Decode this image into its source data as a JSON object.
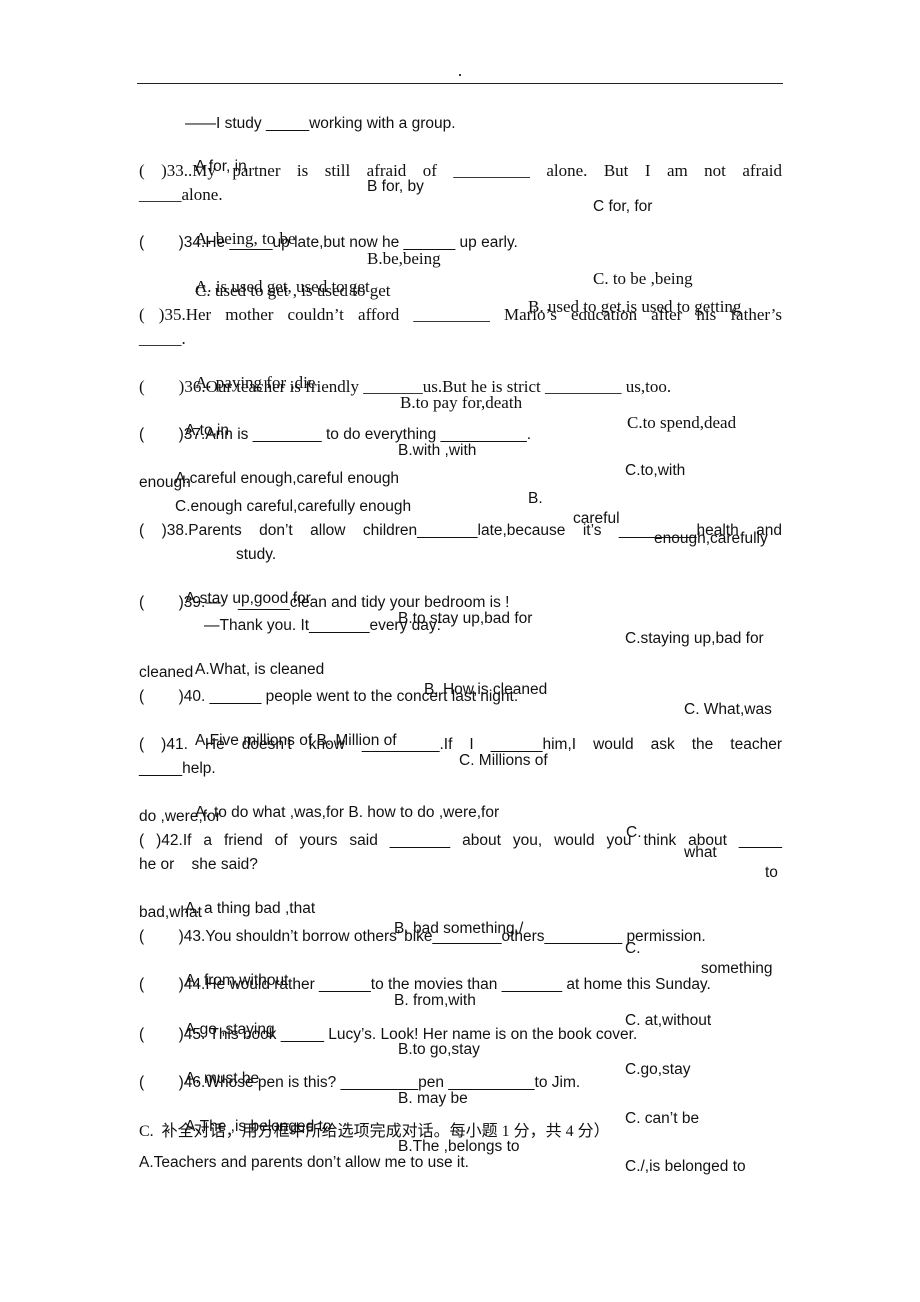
{
  "header": {
    "dot": "."
  },
  "lines": {
    "l01": "——I study _____working with a group.",
    "l02a": "A for, in",
    "l02b": "B for, by",
    "l02c": "C for, for",
    "l03": "(          )33..My partner is still afraid of _________ alone. But I am not afraid",
    "l04": "_____alone.",
    "l05a": "A. being, to be",
    "l05b": "B.be,being",
    "l05c": "C. to be ,being",
    "l06": "(        )34.He _____up late,but now he ______ up early.",
    "l07a": "A. is used get, used to get",
    "l07b": "B. used to get,is used to getting",
    "l08": "C. used to get , is used to get",
    "l09": "(        )35.Her mother couldn’t afford _________ Mario’s education after his father’s",
    "l10": "_____.",
    "l11a": "A. paying for ,die",
    "l11b": "B.to pay for,death",
    "l11c": "C.to spend,dead",
    "l12": "(        )36.Our teacher is friendly _______us.But he is strict _________ us,too.",
    "l13a": "A.to,in",
    "l13b": "B.with ,with",
    "l13c": "C.to,with",
    "l14": "(        )37.Ann is ________ to do everything __________.",
    "l15a": "A.careful enough,careful enough",
    "l15b": "B.",
    "l15c": "careful",
    "l15d": "enough,carefully",
    "l16": "enough",
    "l17": "C.enough careful,carefully enough",
    "l18": "(        )38.Parents don’t allow children_______late,because it’s _________health and",
    "l19": "study.",
    "l20a": "A.stay up,good for",
    "l20b": "B.to stay up,bad for",
    "l20c": "C.staying up,bad for",
    "l21": "(        )39.—    ______clean and tidy your bedroom is !",
    "l22": "—Thank you. It_______every day:",
    "l23a": "A.What, is cleaned",
    "l23b": "B. How,is cleaned",
    "l23c": "C. What,was",
    "l24": "cleaned",
    "l25": "(        )40. ______ people went to the concert last night.",
    "l26a": "A.Five millions of B. Million of",
    "l26b": "C. Millions of",
    "l27": "(          )41. He doesn’t know _________.If I ______him,I would ask the teacher",
    "l28": "_____help.",
    "l29a": "A. to do what ,was,for B. how to do ,were,for",
    "l29b": "C.",
    "l29c": "what",
    "l29d": "to",
    "l30": "do ,were,for",
    "l31": "(        )42.If a friend of yours said _______ about you, would you think about _____",
    "l32": "he or    she said?",
    "l33a": "A. a thing bad ,that",
    "l33b": "B. bad something,/",
    "l33c": "C.",
    "l33d": "something",
    "l34": "bad,what",
    "l35": "(        )43.You shouldn’t borrow others’ bike________others_________ permission.",
    "l36a": "A. from,without",
    "l36b": "B. from,with",
    "l36c": "C. at,without",
    "l37": "(        )44.He would rather ______to the movies than _______ at home this Sunday.",
    "l38a": "A.go ,staying",
    "l38b": "B.to go,stay",
    "l38c": "C.go,stay",
    "l39": "(        )45. This book _____ Lucy’s. Look! Her name is on the book cover.",
    "l40a": "A. must be",
    "l40b": "B. may be",
    "l40c": "C. can’t be",
    "l41": "(        )46.Whose pen is this? _________pen __________to Jim.",
    "l42a": "A.The ,is belonged to",
    "l42b": "B.The ,belongs to",
    "l42c": "C./,is belonged to",
    "l43": "C.  补全对话，用方框中所给选项完成对话。每小题 1 分，共 4 分）",
    "l44": "A.Teachers and parents don’t allow me to use it."
  }
}
